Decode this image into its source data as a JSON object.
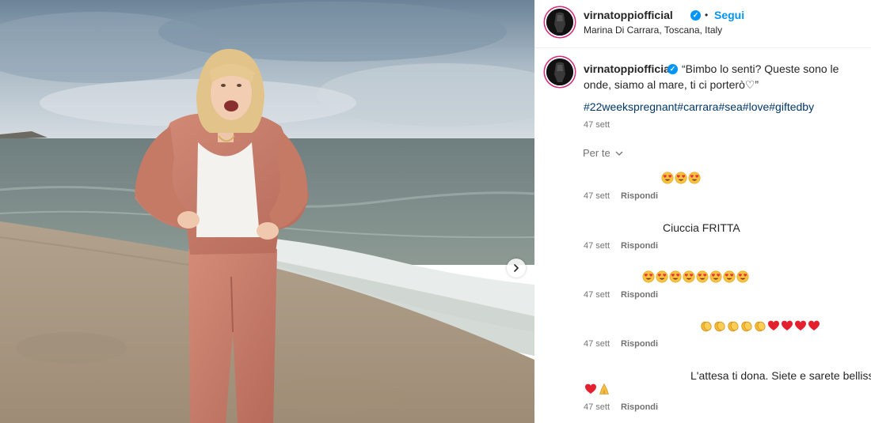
{
  "post": {
    "username": "virnatoppiofficial",
    "follow_label": "Segui",
    "separator": "•",
    "location": "Marina Di Carrara, Toscana, Italy",
    "caption_username": "virnatoppiofficial",
    "caption": "“Bimbo lo senti? Queste sono le onde, siamo al mare, ti ci porterò♡”",
    "hashtags": "#22weekspregnant#carrara#sea#love#giftedby",
    "timestamp": "47 sett",
    "sort_label": "Per te",
    "next_icon": "chevron-right-icon"
  },
  "comments": [
    {
      "text": "😍😍😍",
      "emoji": [
        "face",
        "face",
        "face"
      ],
      "time": "47 sett",
      "reply_label": "Rispondi"
    },
    {
      "text": "Ciuccia FRITTA",
      "time": "47 sett",
      "reply_label": "Rispondi"
    },
    {
      "text": "😍😍😍😍😍😍😍😍",
      "emoji": [
        "face",
        "face",
        "face",
        "face",
        "face",
        "face",
        "face",
        "face"
      ],
      "time": "47 sett",
      "reply_label": "Rispondi"
    },
    {
      "text": "👏👏👏👏👏❤️❤️❤️❤️",
      "emoji": [
        "clap",
        "clap",
        "clap",
        "clap",
        "clap",
        "heart",
        "heart",
        "heart",
        "heart"
      ],
      "time": "47 sett",
      "reply_label": "Rispondi"
    },
    {
      "text": "L'attesa ti dona. Siete e sarete bellissimi",
      "text_emoji": "❤️🙏",
      "emoji": [
        "heart",
        "pray"
      ],
      "time": "47 sett",
      "reply_label": "Rispondi"
    }
  ],
  "colors": {
    "accent_blue": "#0095f6",
    "hashtag": "#00376b",
    "muted": "#737373",
    "text": "#262626",
    "jacket": "#c67a68"
  }
}
